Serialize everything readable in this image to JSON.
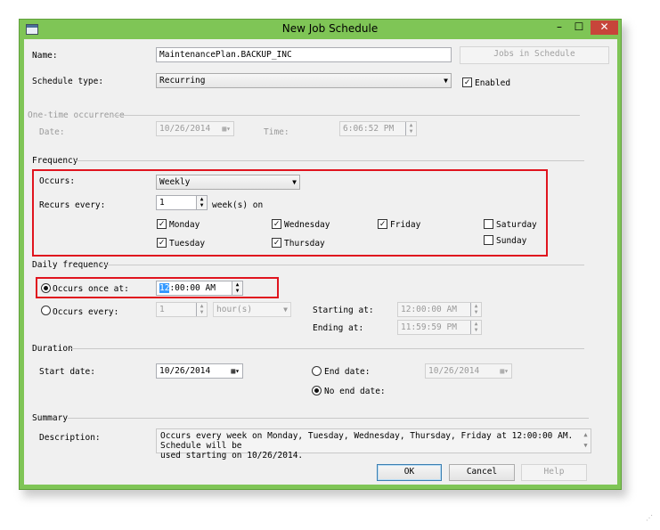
{
  "window": {
    "title": "New Job Schedule",
    "controls": {
      "minimize": "–",
      "maximize": "☐",
      "close": "✕"
    }
  },
  "name": {
    "label": "Name:",
    "value": "MaintenancePlan.BACKUP_INC",
    "jobs_button": "Jobs in Schedule"
  },
  "schedule_type": {
    "label": "Schedule type:",
    "value": "Recurring",
    "enabled_label": "Enabled",
    "enabled": true
  },
  "one_time": {
    "heading": "One-time occurrence",
    "date_label": "Date:",
    "date_value": "10/26/2014",
    "time_label": "Time:",
    "time_value": "6:06:52 PM"
  },
  "frequency": {
    "heading": "Frequency",
    "occurs_label": "Occurs:",
    "occurs_value": "Weekly",
    "recurs_label": "Recurs every:",
    "recurs_value": "1",
    "recurs_unit": "week(s) on",
    "days": {
      "monday": "Monday",
      "tuesday": "Tuesday",
      "wednesday": "Wednesday",
      "thursday": "Thursday",
      "friday": "Friday",
      "saturday": "Saturday",
      "sunday": "Sunday"
    }
  },
  "daily": {
    "heading": "Daily frequency",
    "once_label": "Occurs once at:",
    "once_hour": "12",
    "once_rest": ":00:00 AM",
    "every_label": "Occurs every:",
    "every_value": "1",
    "every_unit": "hour(s)",
    "start_label": "Starting at:",
    "start_value": "12:00:00 AM",
    "end_label": "Ending at:",
    "end_value": "11:59:59 PM"
  },
  "duration": {
    "heading": "Duration",
    "start_label": "Start date:",
    "start_value": "10/26/2014",
    "end_label": "End date:",
    "end_value": "10/26/2014",
    "no_end_label": "No end date:"
  },
  "summary": {
    "heading": "Summary",
    "desc_label": "Description:",
    "desc_line1": "Occurs every week on Monday, Tuesday, Wednesday, Thursday, Friday at 12:00:00 AM. Schedule will be",
    "desc_line2": "used starting on 10/26/2014."
  },
  "buttons": {
    "ok": "OK",
    "cancel": "Cancel",
    "help": "Help"
  },
  "colors": {
    "frame": "#7fc556",
    "highlight": "#e0141e"
  }
}
